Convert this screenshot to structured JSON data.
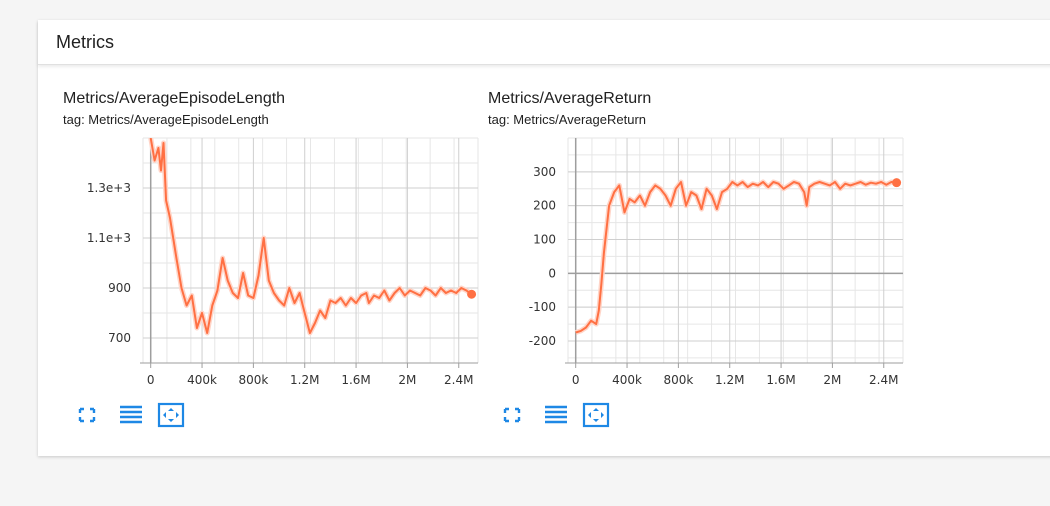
{
  "section": {
    "title": "Metrics"
  },
  "colors": {
    "accent": "#ff7043",
    "light": "#ffd5c8",
    "icon": "#1e88e5",
    "grid": "#cfcfcf",
    "axis": "#9e9e9e"
  },
  "icons": [
    "fullscreen-icon",
    "data-table-icon",
    "fit-domain-icon"
  ],
  "chart_data": [
    {
      "type": "line",
      "title": "Metrics/AverageEpisodeLength",
      "subtitle": "tag: Metrics/AverageEpisodeLength",
      "xlabel": "",
      "ylabel": "",
      "xlim": [
        -0.06,
        2.55
      ],
      "ylim": [
        600,
        1500
      ],
      "x_ticks": [
        0,
        0.4,
        0.8,
        1.2,
        1.6,
        2.0,
        2.4
      ],
      "x_tick_labels": [
        "0",
        "400k",
        "800k",
        "1.2M",
        "1.6M",
        "2M",
        "2.4M"
      ],
      "y_ticks": [
        700,
        900,
        1100,
        1300
      ],
      "y_tick_labels": [
        "700",
        "900",
        "1.1e+3",
        "1.3e+3"
      ],
      "grid": true,
      "series": [
        {
          "x": [
            0.0,
            0.03,
            0.06,
            0.08,
            0.1,
            0.12,
            0.15,
            0.2,
            0.24,
            0.28,
            0.32,
            0.36,
            0.4,
            0.44,
            0.48,
            0.5,
            0.52,
            0.56,
            0.6,
            0.64,
            0.68,
            0.72,
            0.76,
            0.8,
            0.84,
            0.88,
            0.92,
            0.96,
            1.0,
            1.04,
            1.08,
            1.12,
            1.16,
            1.2,
            1.24,
            1.28,
            1.32,
            1.36,
            1.4,
            1.44,
            1.48,
            1.52,
            1.56,
            1.6,
            1.64,
            1.68,
            1.7,
            1.74,
            1.78,
            1.82,
            1.86,
            1.9,
            1.94,
            1.98,
            2.02,
            2.06,
            2.1,
            2.14,
            2.18,
            2.22,
            2.26,
            2.3,
            2.34,
            2.38,
            2.42,
            2.46,
            2.5
          ],
          "values": [
            1500,
            1410,
            1460,
            1370,
            1480,
            1250,
            1180,
            1020,
            900,
            830,
            870,
            740,
            800,
            720,
            830,
            860,
            890,
            1020,
            930,
            880,
            860,
            960,
            870,
            860,
            950,
            1100,
            930,
            880,
            850,
            830,
            900,
            840,
            880,
            800,
            720,
            760,
            810,
            780,
            850,
            840,
            860,
            830,
            860,
            840,
            870,
            880,
            840,
            870,
            860,
            890,
            850,
            880,
            900,
            870,
            890,
            880,
            870,
            900,
            890,
            870,
            900,
            880,
            890,
            880,
            900,
            890,
            875
          ]
        }
      ]
    },
    {
      "type": "line",
      "title": "Metrics/AverageReturn",
      "subtitle": "tag: Metrics/AverageReturn",
      "xlabel": "",
      "ylabel": "",
      "xlim": [
        -0.06,
        2.55
      ],
      "ylim": [
        -265,
        400
      ],
      "x_ticks": [
        0,
        0.4,
        0.8,
        1.2,
        1.6,
        2.0,
        2.4
      ],
      "x_tick_labels": [
        "0",
        "400k",
        "800k",
        "1.2M",
        "1.6M",
        "2M",
        "2.4M"
      ],
      "y_ticks": [
        -200,
        -100,
        0,
        100,
        200,
        300
      ],
      "y_tick_labels": [
        "-200",
        "-100",
        "0",
        "100",
        "200",
        "300"
      ],
      "grid": true,
      "series": [
        {
          "x": [
            0.0,
            0.04,
            0.08,
            0.12,
            0.16,
            0.18,
            0.2,
            0.22,
            0.24,
            0.26,
            0.3,
            0.34,
            0.38,
            0.42,
            0.46,
            0.5,
            0.54,
            0.58,
            0.62,
            0.66,
            0.7,
            0.74,
            0.78,
            0.82,
            0.86,
            0.9,
            0.94,
            0.98,
            1.02,
            1.06,
            1.1,
            1.14,
            1.18,
            1.22,
            1.26,
            1.3,
            1.34,
            1.38,
            1.42,
            1.46,
            1.5,
            1.54,
            1.58,
            1.62,
            1.66,
            1.7,
            1.74,
            1.78,
            1.8,
            1.82,
            1.86,
            1.9,
            1.94,
            1.98,
            2.02,
            2.06,
            2.1,
            2.14,
            2.18,
            2.22,
            2.26,
            2.3,
            2.34,
            2.38,
            2.42,
            2.46,
            2.5
          ],
          "values": [
            -175,
            -170,
            -160,
            -140,
            -150,
            -110,
            -30,
            60,
            130,
            200,
            240,
            260,
            180,
            220,
            210,
            230,
            200,
            240,
            260,
            250,
            230,
            200,
            250,
            270,
            200,
            240,
            230,
            190,
            250,
            230,
            190,
            240,
            250,
            270,
            260,
            270,
            255,
            265,
            260,
            270,
            255,
            270,
            265,
            250,
            260,
            270,
            265,
            240,
            200,
            255,
            265,
            270,
            265,
            260,
            270,
            250,
            265,
            260,
            265,
            270,
            262,
            268,
            265,
            270,
            262,
            270,
            268
          ]
        }
      ]
    }
  ]
}
